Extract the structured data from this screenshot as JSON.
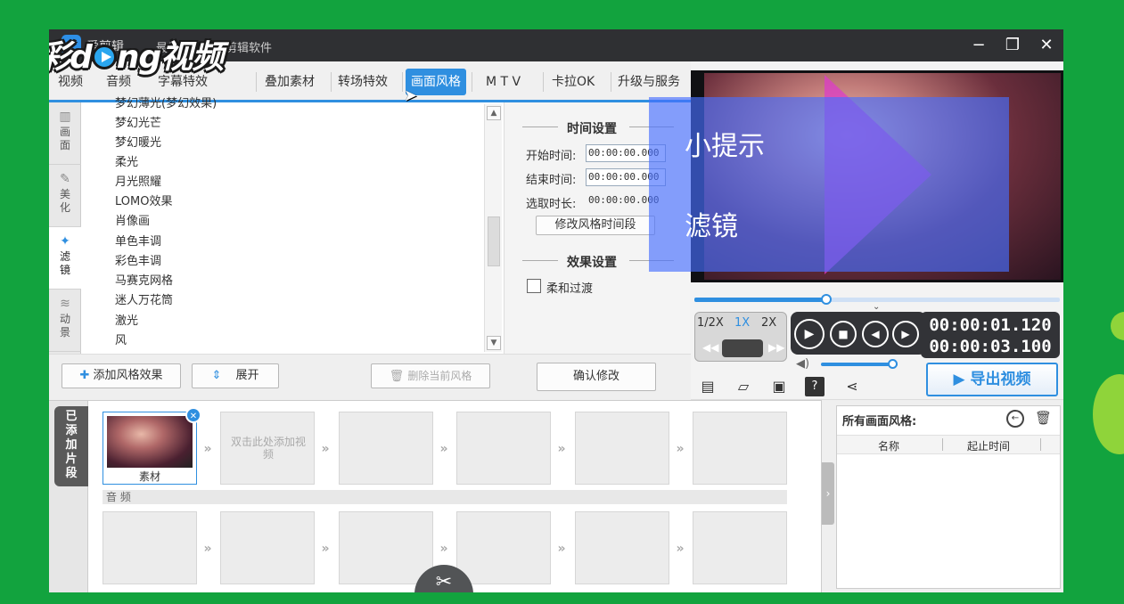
{
  "watermark": {
    "logo_left": "彩d",
    "logo_right": "ng视频"
  },
  "window": {
    "app_name": "爱剪辑",
    "slogan": "最易用…的…剪辑软件",
    "min": "−",
    "max": "❐",
    "close": "✕"
  },
  "tabs": [
    {
      "label": "视频"
    },
    {
      "label": "音频"
    },
    {
      "label": "字幕特效"
    },
    {
      "label": "叠加素材"
    },
    {
      "label": "转场特效"
    },
    {
      "label": "画面风格",
      "active": true
    },
    {
      "label": "M T V"
    },
    {
      "label": "卡拉OK"
    },
    {
      "label": "升级与服务"
    }
  ],
  "sidetabs": [
    {
      "label": "画面",
      "icon": "▥"
    },
    {
      "label": "美化",
      "icon": "✎"
    },
    {
      "label": "滤镜",
      "icon": "✦"
    },
    {
      "label": "动景",
      "icon": "≋"
    }
  ],
  "filter_items": [
    "梦幻薄光(梦幻效果)",
    "梦幻光芒",
    "梦幻暖光",
    "柔光",
    "月光照耀",
    "LOMO效果",
    "肖像画",
    "单色丰调",
    "彩色丰调",
    "马赛克网格",
    "迷人万花筒",
    "激光",
    "风"
  ],
  "settings": {
    "time_section": "时间设置",
    "start_label": "开始时间:",
    "start_value": "00:00:00.000",
    "end_label": "结束时间:",
    "end_value": "00:00:00.000",
    "duration_label": "选取时长:",
    "duration_value": "00:00:00.000",
    "modify_time_button": "修改风格时间段",
    "effect_section": "效果设置",
    "smooth_label": "柔和过渡",
    "confirm_button": "确认修改"
  },
  "bottombar": {
    "add_effect": "添加风格效果",
    "expand": "展开",
    "delete_current": "删除当前风格"
  },
  "preview": {
    "tip_title": "小提示",
    "tip_text": "滤镜"
  },
  "player": {
    "speeds": [
      "1/2X",
      "1X",
      "2X"
    ],
    "time_current": "00:00:01.120",
    "time_total": "00:00:03.100",
    "export_label": "导出视频",
    "progress": 0.36,
    "volume": 0.94
  },
  "timeline": {
    "tab_label": "已添加片段",
    "clip_label": "素材",
    "add_hint": "双击此处添加视频",
    "audio_label": "音 频"
  },
  "right_panel": {
    "title": "所有画面风格:",
    "col_name": "名称",
    "col_time": "起止时间"
  }
}
